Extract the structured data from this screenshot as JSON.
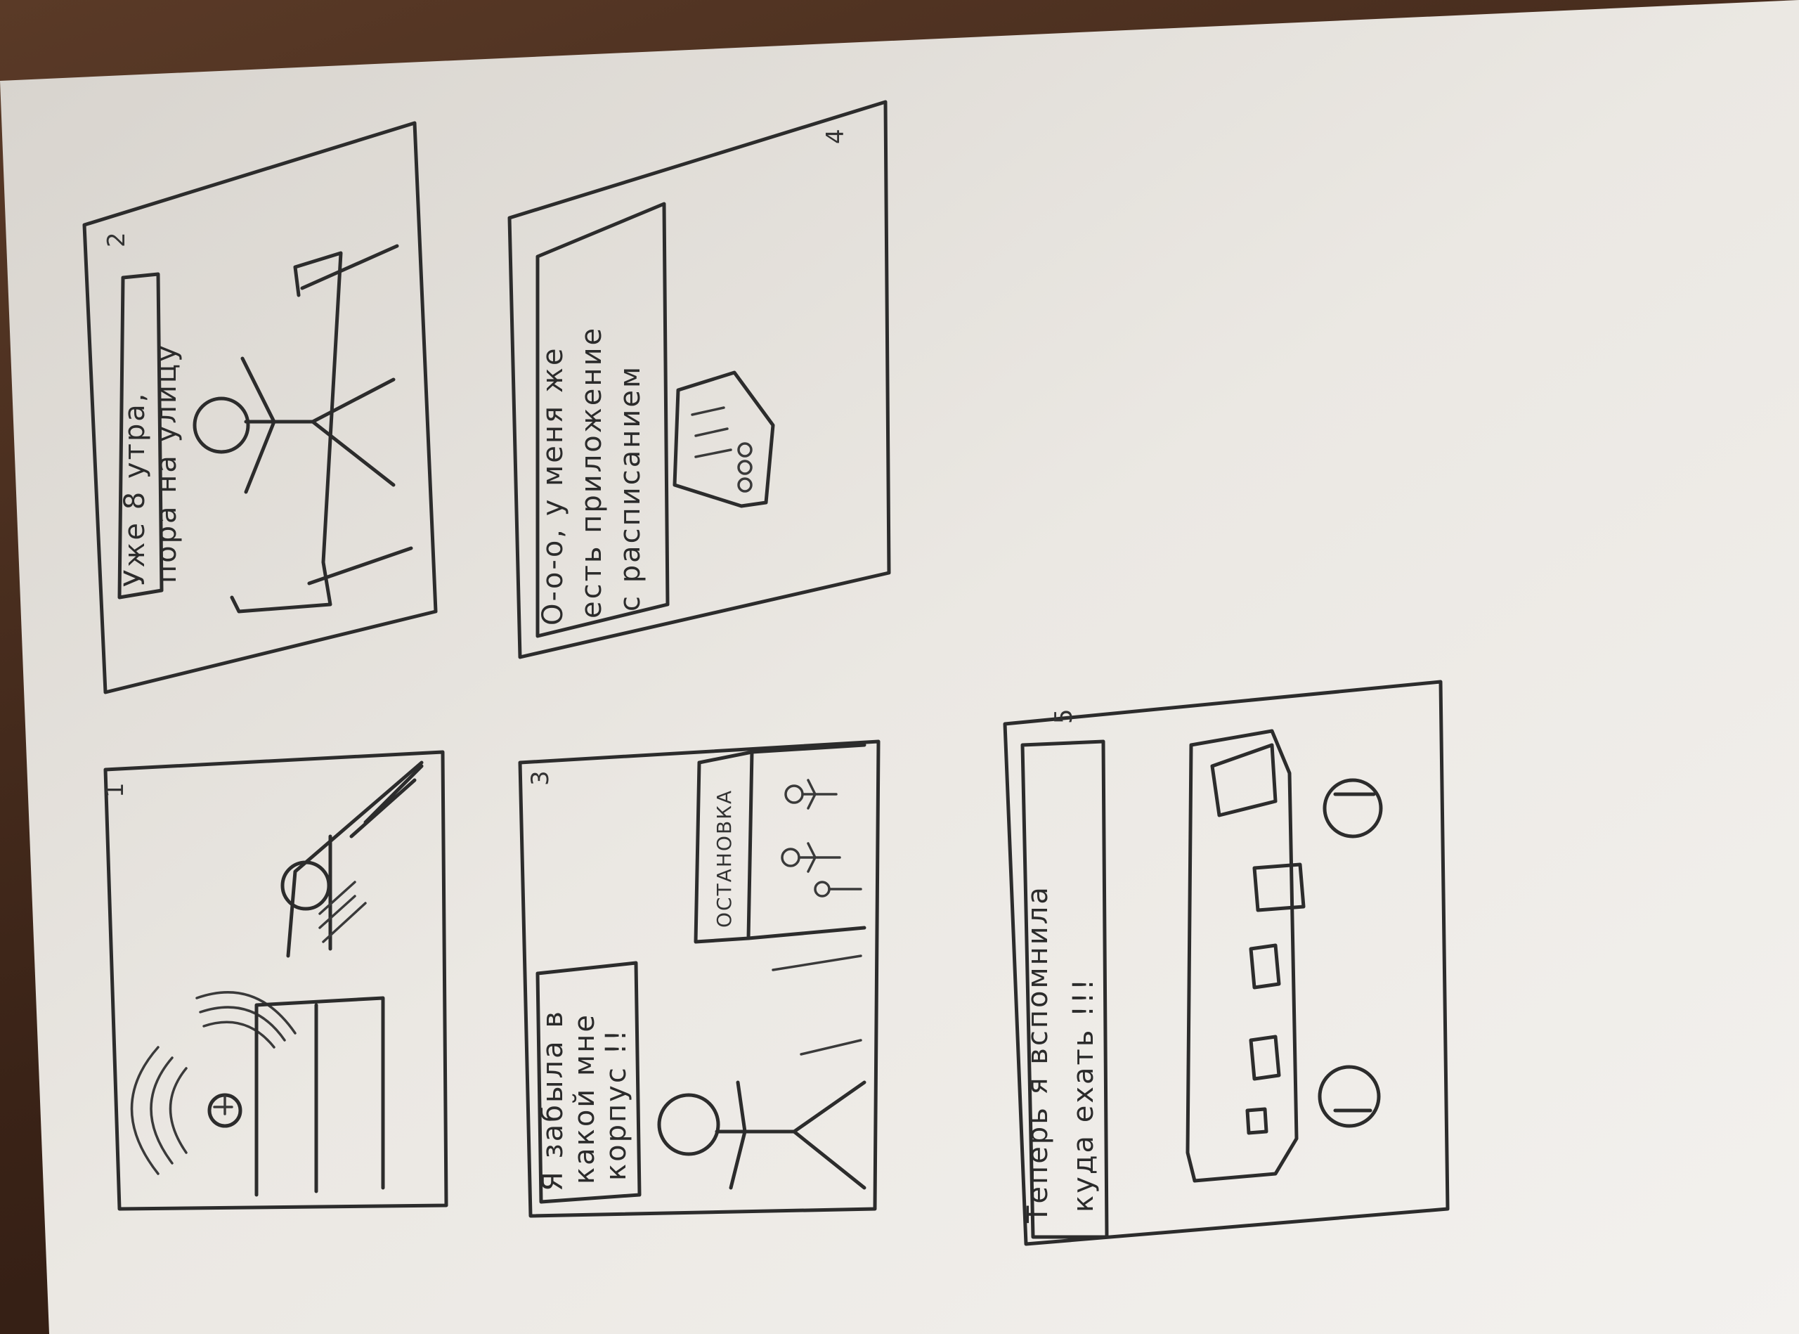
{
  "colors": {
    "paper": "#e9e6e1",
    "ink": "#2c2c2c",
    "table": "#3b2418"
  },
  "panels": [
    {
      "number": "1",
      "caption": ""
    },
    {
      "number": "2",
      "caption": [
        "Уже 8 утра,",
        "пора на улицу"
      ]
    },
    {
      "number": "3",
      "caption": [
        "Я забыла в",
        "какой мне",
        "корпус !!"
      ],
      "sign": "ОСТАНОВКА"
    },
    {
      "number": "4",
      "caption": [
        "О-о-о, у меня же",
        "есть приложение",
        "с расписанием"
      ]
    },
    {
      "number": "5",
      "caption": [
        "Теперь я вспомнила",
        "куда ехать !!!"
      ]
    }
  ]
}
